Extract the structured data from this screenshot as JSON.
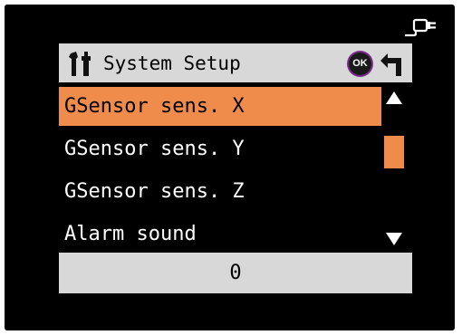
{
  "header": {
    "title": "System Setup",
    "ok_label": "OK"
  },
  "menu": {
    "items": [
      {
        "label": "GSensor sens. X",
        "selected": true
      },
      {
        "label": "GSensor sens. Y",
        "selected": false
      },
      {
        "label": "GSensor sens. Z",
        "selected": false
      },
      {
        "label": "Alarm sound",
        "selected": false
      }
    ]
  },
  "value": {
    "current": "0"
  },
  "colors": {
    "screen_background": "#000000",
    "header_background": "#d8d8d8",
    "highlight": "#ef8c4c",
    "ok_ring": "#7a2b8a",
    "text_light": "#ffffff",
    "text_dark": "#000000"
  },
  "icons": {
    "status": "power-plug-icon",
    "header": "tools-icon",
    "back": "back-arrow-icon",
    "scroll_up": "triangle-up-icon",
    "scroll_down": "triangle-down-icon"
  }
}
